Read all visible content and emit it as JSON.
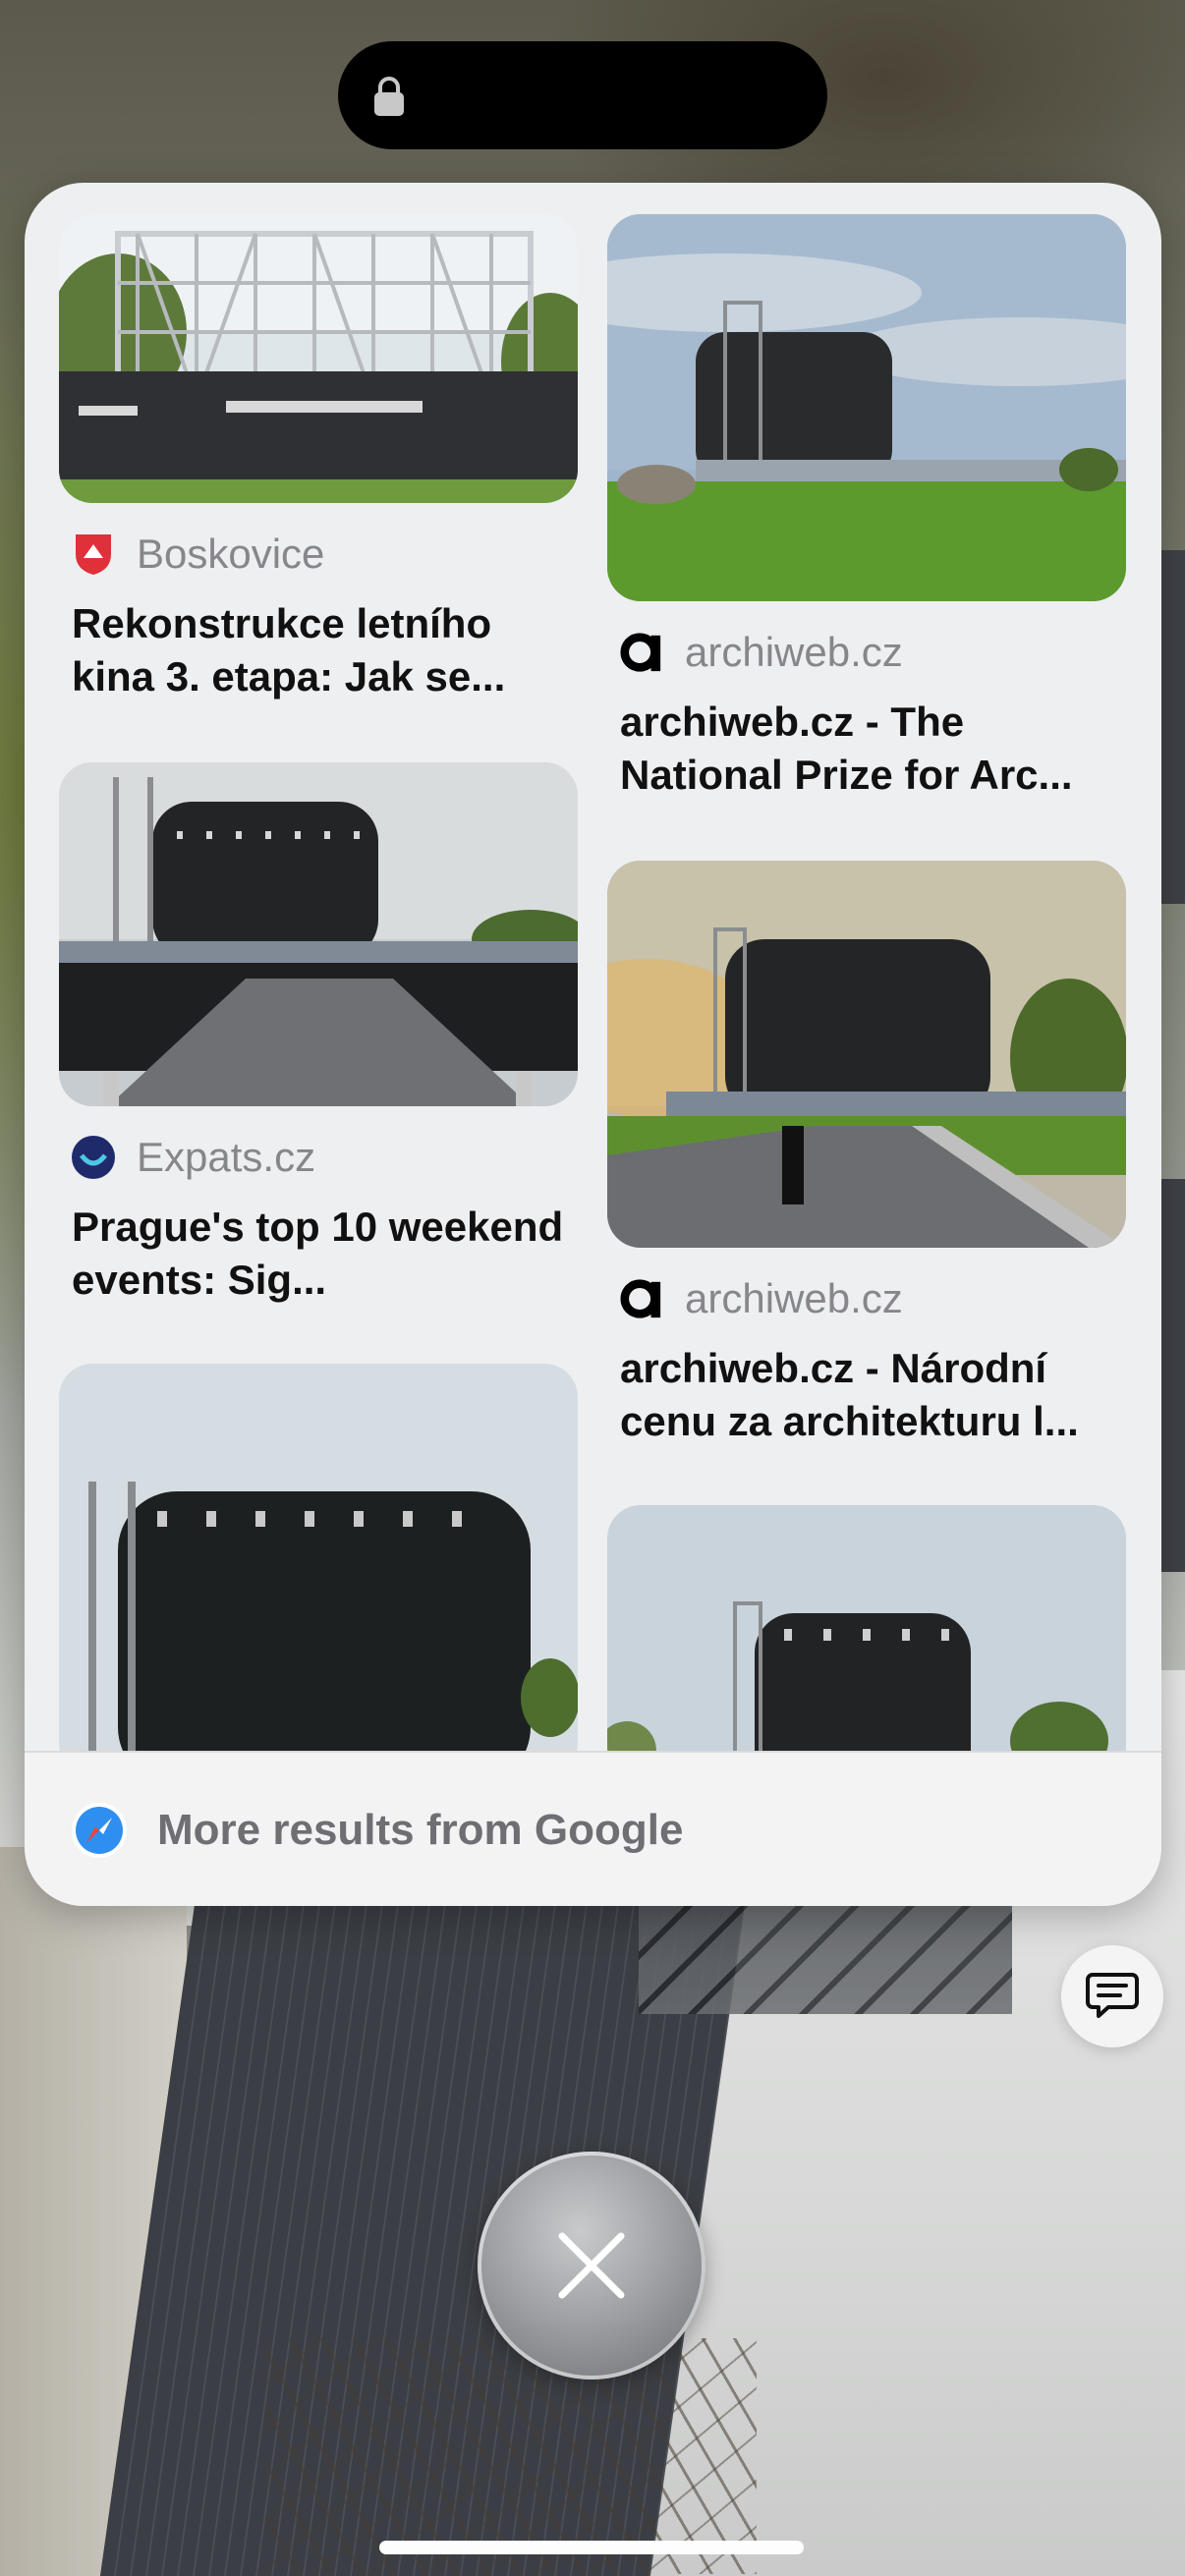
{
  "results": {
    "left": [
      {
        "source": "Boskovice",
        "title": "Rekonstrukce letního kina 3. etapa: Jak se...",
        "icon": "boskovice-crest-icon"
      },
      {
        "source": "Expats.cz",
        "title": "Prague's top 10 weekend events: Sig...",
        "icon": "expats-smile-icon"
      }
    ],
    "right": [
      {
        "source": "archiweb.cz",
        "title": "archiweb.cz - The National Prize for Arc...",
        "icon": "archiweb-a-icon"
      },
      {
        "source": "archiweb.cz",
        "title": "archiweb.cz - Národní cenu za architekturu l...",
        "icon": "archiweb-a-icon"
      }
    ]
  },
  "more_results": {
    "label": "More results from Google",
    "icon": "safari-compass-icon"
  },
  "colors": {
    "panel": "#eeeff1",
    "source_text": "#86868b",
    "title_text": "#111111",
    "boskovice_red": "#e0303a",
    "expats_navy": "#1f2a6b"
  },
  "controls": {
    "chat_icon": "chat-bubble-icon",
    "close_icon": "close-icon",
    "lock_icon": "lock-icon"
  }
}
